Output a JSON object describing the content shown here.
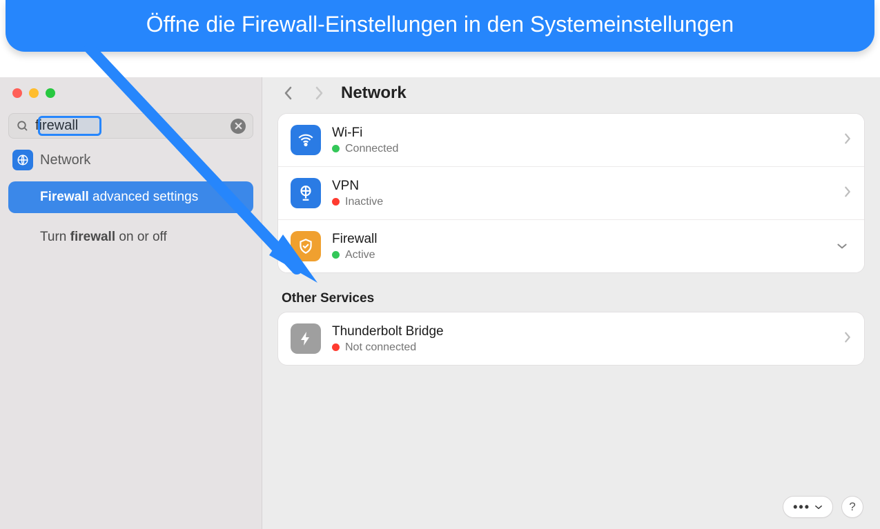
{
  "banner": {
    "text": "Öffne die Firewall-Einstellungen in den Systemeinstellungen"
  },
  "sidebar": {
    "search_value": "firewall",
    "heading": "Network",
    "results": [
      {
        "prefix": "Firewall",
        "rest": " advanced settings"
      },
      {
        "prefix": "Turn ",
        "bold": "firewall",
        "rest": " on or off"
      }
    ]
  },
  "content": {
    "title": "Network",
    "other_heading": "Other Services",
    "rows": {
      "wifi": {
        "title": "Wi-Fi",
        "status": "Connected",
        "dot": "green"
      },
      "vpn": {
        "title": "VPN",
        "status": "Inactive",
        "dot": "red"
      },
      "firewall": {
        "title": "Firewall",
        "status": "Active",
        "dot": "green"
      },
      "tb": {
        "title": "Thunderbolt Bridge",
        "status": "Not connected",
        "dot": "red"
      }
    },
    "more_label": "•••",
    "help_label": "?"
  }
}
